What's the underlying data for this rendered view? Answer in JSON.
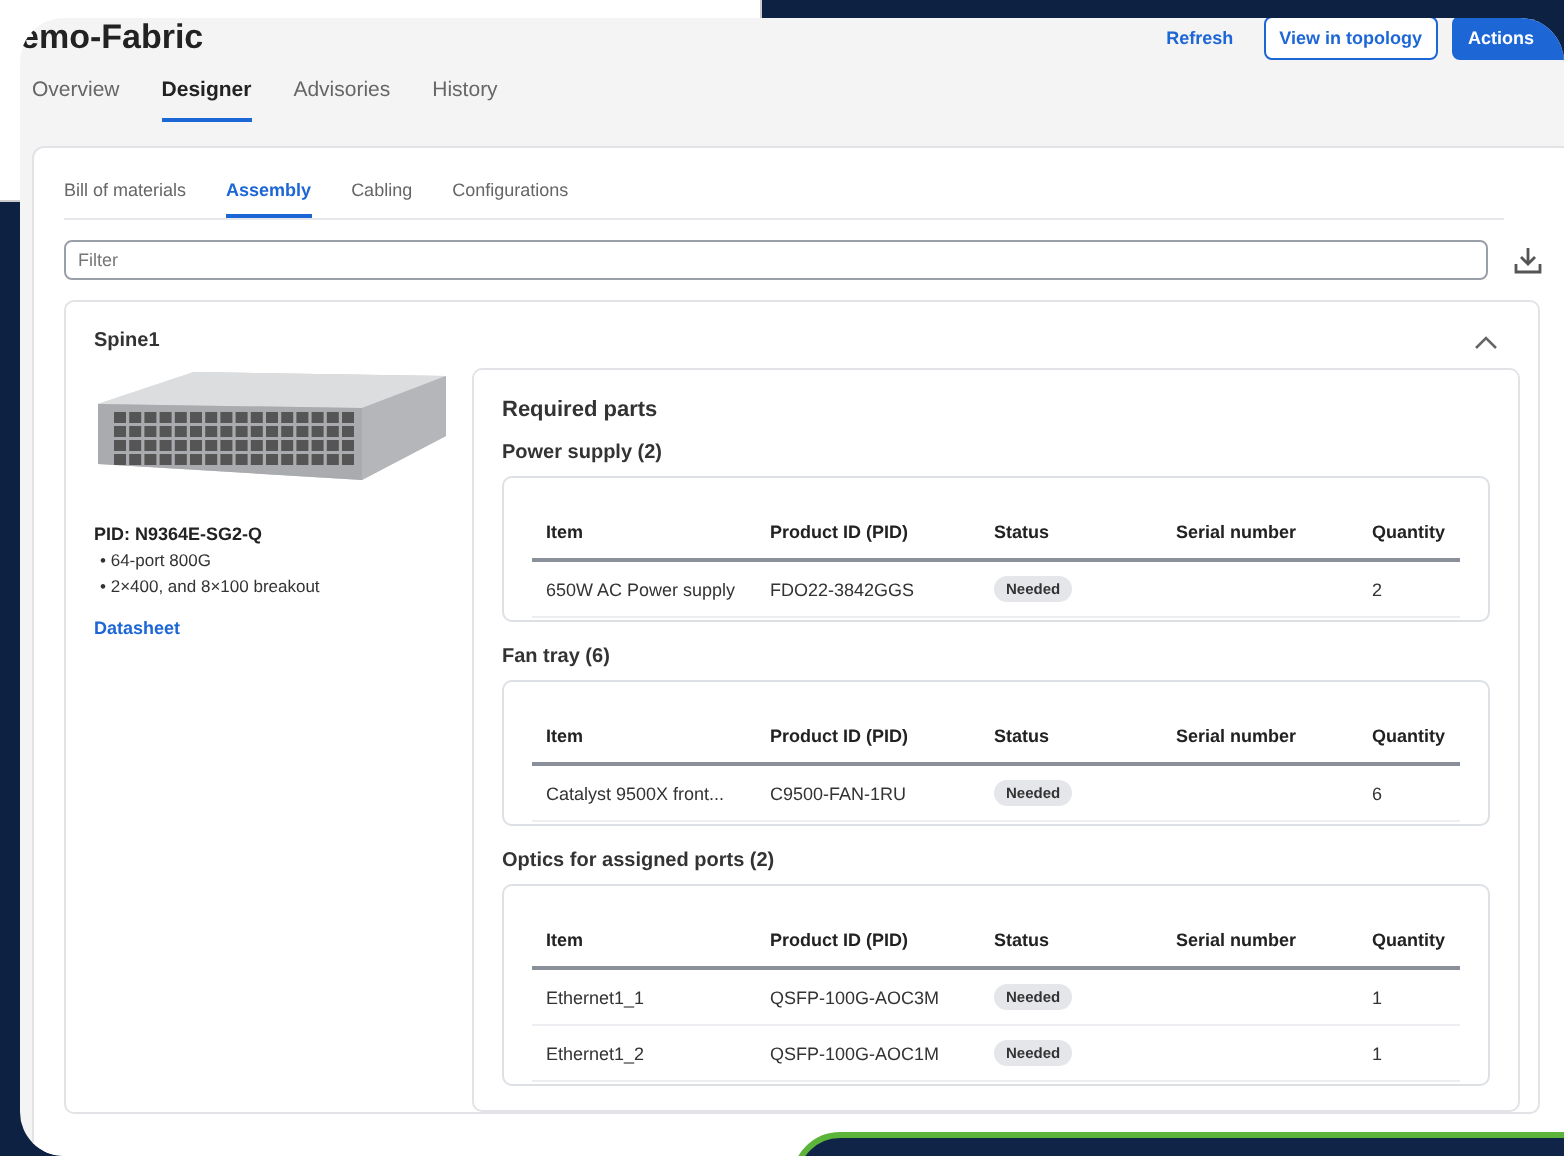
{
  "header": {
    "title": "emo-Fabric",
    "actions": [
      {
        "label": "Refresh",
        "kind": "link"
      },
      {
        "label": "View in topology",
        "kind": "outline"
      },
      {
        "label": "Actions",
        "kind": "primary"
      }
    ]
  },
  "tabs": [
    {
      "label": "Overview",
      "selected": false
    },
    {
      "label": "Designer",
      "selected": true
    },
    {
      "label": "Advisories",
      "selected": false
    },
    {
      "label": "History",
      "selected": false
    }
  ],
  "subtabs": [
    {
      "label": "Bill of materials",
      "selected": false
    },
    {
      "label": "Assembly",
      "selected": true
    },
    {
      "label": "Cabling",
      "selected": false
    },
    {
      "label": "Configurations",
      "selected": false
    }
  ],
  "filter": {
    "placeholder": "Filter"
  },
  "device": {
    "name": "Spine1",
    "expanded": true,
    "pid": "PID: N9364E-SG2-Q",
    "features": [
      "• 64-port 800G",
      "• 2×400, and 8×100 breakout"
    ],
    "link": "Datasheet"
  },
  "required_parts": {
    "title": "Required parts",
    "groups": [
      {
        "title": "Power supply (2)",
        "columns": [
          "Item",
          "Product ID (PID)",
          "Status",
          "Serial number",
          "Quantity"
        ],
        "rows": [
          {
            "item": "650W AC Power supply",
            "pid": "FDO22-3842GGS",
            "status": "Needed",
            "quantity": "2"
          }
        ]
      },
      {
        "title": "Fan tray (6)",
        "columns": [
          "Item",
          "Product ID (PID)",
          "Status",
          "Serial number",
          "Quantity"
        ],
        "rows": [
          {
            "item": "Catalyst 9500X front...",
            "pid": "C9500-FAN-1RU",
            "status": "Needed",
            "quantity": "6"
          }
        ]
      },
      {
        "title": "Optics for assigned ports (2)",
        "columns": [
          "Item",
          "Product ID (PID)",
          "Status",
          "Serial number",
          "Quantity"
        ],
        "rows": [
          {
            "item": "Ethernet1_1",
            "pid": "QSFP-100G-AOC3M",
            "status": "Needed",
            "quantity": "1"
          },
          {
            "item": "Ethernet1_2",
            "pid": "QSFP-100G-AOC1M",
            "status": "Needed",
            "quantity": "1"
          }
        ]
      }
    ]
  }
}
